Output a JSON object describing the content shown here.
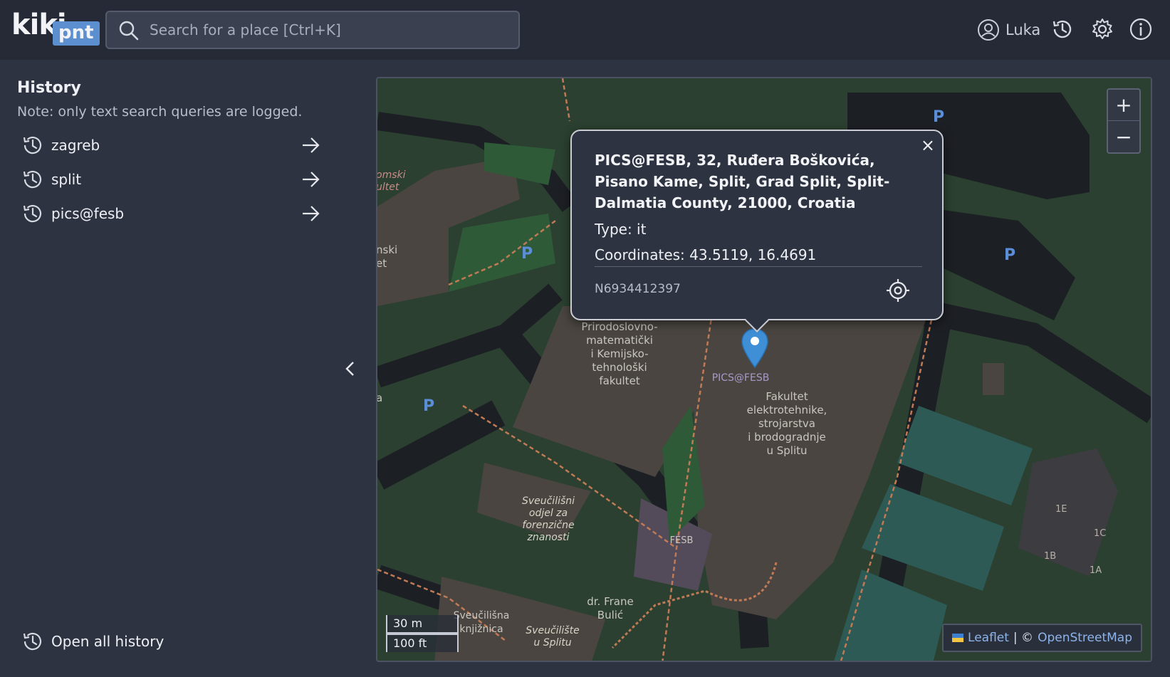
{
  "app": {
    "logo_main": "kiki",
    "logo_badge": "pnt"
  },
  "header": {
    "search_placeholder": "Search for a place [Ctrl+K]",
    "user_name": "Luka",
    "icons": [
      "search-icon",
      "user-icon",
      "history-icon",
      "gear-icon",
      "info-icon"
    ]
  },
  "sidebar": {
    "title": "History",
    "note": "Note: only text search queries are logged.",
    "items": [
      {
        "label": "zagreb"
      },
      {
        "label": "split"
      },
      {
        "label": "pics@fesb"
      }
    ],
    "open_all_label": "Open all history"
  },
  "map": {
    "zoom_in": "+",
    "zoom_out": "−",
    "scale_metric": "30 m",
    "scale_imperial": "100 ft",
    "attribution_leaflet": "Leaflet",
    "attribution_sep": "| ©",
    "attribution_osm": "OpenStreetMap",
    "popup": {
      "title": "PICS@FESB, 32, Ruđera Boškovića, Pisano Kame, Split, Grad Split, Split-Dalmatia County, 21000, Croatia",
      "type_line": "Type: it",
      "coords_line": "Coordinates: 43.5119, 16.4691",
      "osm_id": "N6934412397",
      "close": "×"
    },
    "labels": {
      "marker_label": "PICS@FESB",
      "pmf": "Prirodoslovno-\nmatematički\ni Kemijsko-\ntehnološki\nfakultet",
      "fesb_building": "Fakultet\nelektrotehnike,\nstrojarstva\ni brodogradnje\nu Splitu",
      "forenzicne": "Sveučilišni\nodjel za\nforenzične\nznanosti",
      "fesb_cafe": "FESB",
      "bulic": "dr. Frane\nBulić",
      "knjiznica": "Sveučilišna\nknjižnica",
      "sveuciliste": "Sveučilište\nu Splitu",
      "edge1": "omski\nultet",
      "edge2": "nski\net",
      "edge3": "a",
      "parking": "P",
      "b1e": "1E",
      "b1c": "1C",
      "b1b": "1B",
      "b1a": "1A"
    },
    "colors": {
      "grass": "#2b4030",
      "building": "#4a4540",
      "road": "#1e2126",
      "path": "#c07a55",
      "water_like": "#2d5a55",
      "marker": "#3e8fd6"
    }
  }
}
